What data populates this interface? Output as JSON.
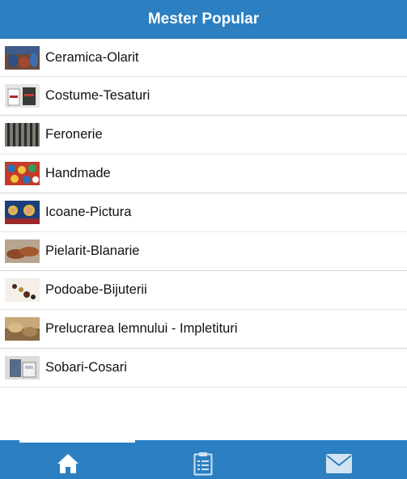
{
  "header": {
    "title": "Mester Popular"
  },
  "categories": [
    {
      "label": "Ceramica-Olarit",
      "thumb": "ceramics-thumb"
    },
    {
      "label": "Costume-Tesaturi",
      "thumb": "costumes-thumb"
    },
    {
      "label": "Feronerie",
      "thumb": "ironwork-thumb"
    },
    {
      "label": "Handmade",
      "thumb": "handmade-thumb"
    },
    {
      "label": "Icoane-Pictura",
      "thumb": "icons-thumb"
    },
    {
      "label": "Pielarit-Blanarie",
      "thumb": "leather-thumb"
    },
    {
      "label": "Podoabe-Bijuterii",
      "thumb": "jewelry-thumb"
    },
    {
      "label": "Prelucrarea lemnului - Impletituri",
      "thumb": "woodwork-thumb"
    },
    {
      "label": "Sobari-Cosari",
      "thumb": "stoves-thumb"
    }
  ],
  "tabbar": {
    "tabs": [
      {
        "icon": "home-icon",
        "active": true
      },
      {
        "icon": "clipboard-icon",
        "active": false
      },
      {
        "icon": "mail-icon",
        "active": false
      }
    ]
  },
  "colors": {
    "header_bg": "#2c7fc1",
    "tabbar_bg": "#2c7fc1",
    "text": "#111111",
    "divider": "#d9d9d9"
  }
}
